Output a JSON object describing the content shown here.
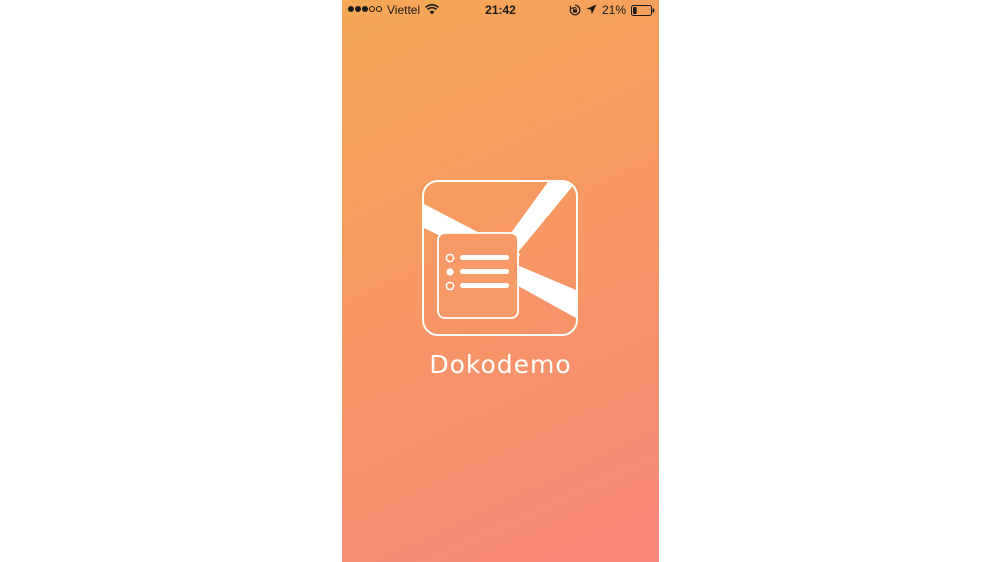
{
  "status_bar": {
    "signal_filled": 3,
    "signal_total": 5,
    "carrier": "Viettel",
    "time": "21:42",
    "battery_percent": "21%",
    "battery_level": 0.21,
    "icons": [
      "wifi-icon",
      "orientation-lock-icon",
      "location-arrow-icon",
      "battery-icon"
    ]
  },
  "app": {
    "name": "Dokodemo",
    "logo_icon": "envelope-list-icon"
  },
  "colors": {
    "gradient_start": "#f6a855",
    "gradient_end": "#f9877a",
    "text_light": "#ffffff"
  }
}
